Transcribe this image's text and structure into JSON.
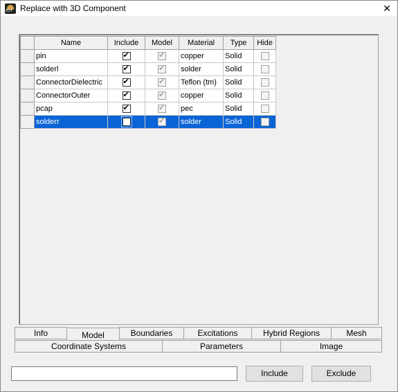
{
  "window": {
    "title": "Replace with 3D Component",
    "close_label": "✕"
  },
  "grid": {
    "columns": [
      "Name",
      "Include",
      "Model",
      "Material",
      "Type",
      "Hide"
    ],
    "rows": [
      {
        "name": "pin",
        "include": true,
        "model": true,
        "material": "copper",
        "type": "Solid",
        "hide": false,
        "selected": false
      },
      {
        "name": "solderl",
        "include": true,
        "model": true,
        "material": "solder",
        "type": "Solid",
        "hide": false,
        "selected": false
      },
      {
        "name": "ConnectorDielectric",
        "include": true,
        "model": true,
        "material": "Teflon (tm)",
        "type": "Solid",
        "hide": false,
        "selected": false
      },
      {
        "name": "ConnectorOuter",
        "include": true,
        "model": true,
        "material": "copper",
        "type": "Solid",
        "hide": false,
        "selected": false
      },
      {
        "name": "pcap",
        "include": true,
        "model": true,
        "material": "pec",
        "type": "Solid",
        "hide": false,
        "selected": false
      },
      {
        "name": "solderr",
        "include": false,
        "model": true,
        "material": "solder",
        "type": "Solid",
        "hide": false,
        "selected": true
      }
    ]
  },
  "tabs": {
    "row1": [
      "Info",
      "Model",
      "Boundaries",
      "Excitations",
      "Hybrid Regions",
      "Mesh"
    ],
    "row2": [
      "Coordinate Systems",
      "Parameters",
      "Image"
    ],
    "active": "Model"
  },
  "footer": {
    "filter_value": "",
    "include_label": "Include",
    "exclude_label": "Exclude"
  }
}
